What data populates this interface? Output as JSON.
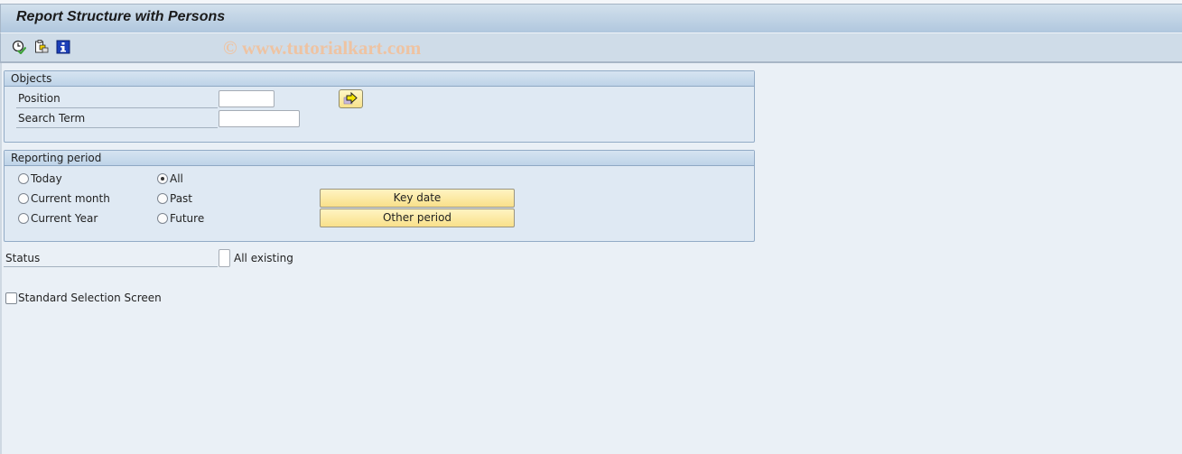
{
  "window": {
    "title": "Report Structure with Persons",
    "watermark": "© www.tutorialkart.com"
  },
  "toolbar": {
    "icons": [
      {
        "name": "execute-clock-icon",
        "tooltip": "Execute"
      },
      {
        "name": "copy-objects-icon",
        "tooltip": "Copy"
      },
      {
        "name": "info-icon",
        "tooltip": "Information"
      }
    ]
  },
  "objects": {
    "title": "Objects",
    "position_label": "Position",
    "position_value": "",
    "search_term_label": "Search Term",
    "search_term_value": ""
  },
  "reporting_period": {
    "title": "Reporting period",
    "options_left": [
      {
        "label": "Today",
        "selected": false
      },
      {
        "label": "Current month",
        "selected": false
      },
      {
        "label": "Current Year",
        "selected": false
      }
    ],
    "options_right": [
      {
        "label": "All",
        "selected": true
      },
      {
        "label": "Past",
        "selected": false
      },
      {
        "label": "Future",
        "selected": false
      }
    ],
    "key_date_button": "Key date",
    "other_period_button": "Other period"
  },
  "status": {
    "label": "Status",
    "value": "",
    "description": "All existing"
  },
  "standard_selection": {
    "label": "Standard Selection Screen",
    "checked": false
  },
  "colors": {
    "button_yellow": "#f9e08a",
    "group_header": "#bed3e8",
    "background": "#eaf0f6"
  }
}
